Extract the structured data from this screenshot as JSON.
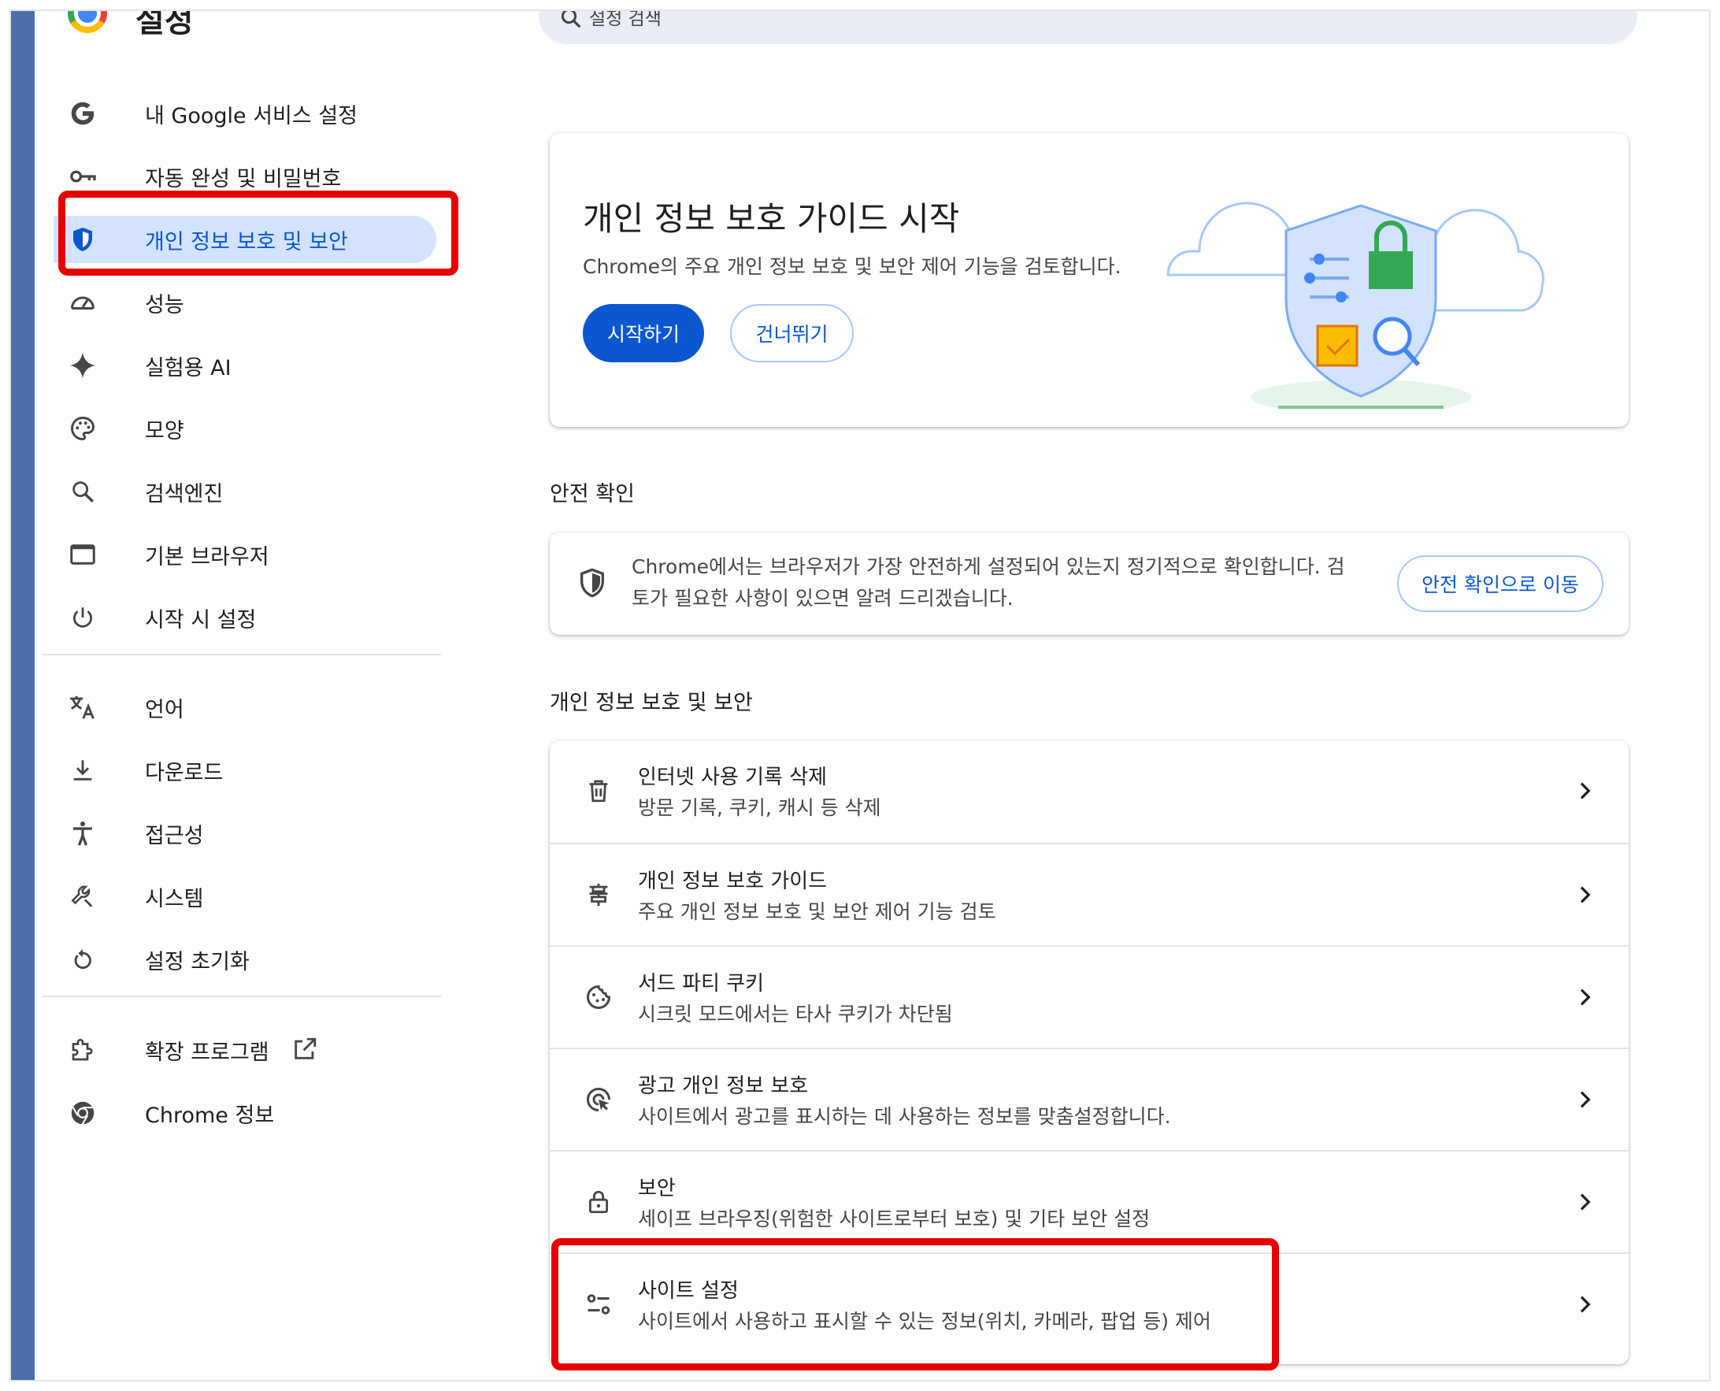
{
  "header": {
    "title": "설정",
    "search_placeholder": "설정 검색"
  },
  "sidebar": {
    "items": [
      {
        "label": "내 Google 서비스 설정",
        "icon": "google-g-icon"
      },
      {
        "label": "자동 완성 및 비밀번호",
        "icon": "key-icon"
      },
      {
        "label": "개인 정보 보호 및 보안",
        "icon": "shield-icon",
        "active": true
      },
      {
        "label": "성능",
        "icon": "speedometer-icon"
      },
      {
        "label": "실험용 AI",
        "icon": "sparkle-icon"
      },
      {
        "label": "모양",
        "icon": "palette-icon"
      },
      {
        "label": "검색엔진",
        "icon": "search-icon"
      },
      {
        "label": "기본 브라우저",
        "icon": "browser-window-icon"
      },
      {
        "label": "시작 시 설정",
        "icon": "power-icon"
      },
      {
        "label": "언어",
        "icon": "translate-icon"
      },
      {
        "label": "다운로드",
        "icon": "download-icon"
      },
      {
        "label": "접근성",
        "icon": "accessibility-icon"
      },
      {
        "label": "시스템",
        "icon": "wrench-icon"
      },
      {
        "label": "설정 초기화",
        "icon": "reset-icon"
      },
      {
        "label": "확장 프로그램",
        "icon": "puzzle-icon"
      },
      {
        "label": "Chrome 정보",
        "icon": "chrome-icon"
      }
    ]
  },
  "guide_card": {
    "title": "개인 정보 보호 가이드 시작",
    "subtitle": "Chrome의 주요 개인 정보 보호 및 보안 제어 기능을 검토합니다.",
    "start_button": "시작하기",
    "skip_button": "건너뛰기"
  },
  "safety_check": {
    "heading": "안전 확인",
    "text": "Chrome에서는 브라우저가 가장 안전하게 설정되어 있는지 정기적으로 확인합니다. 검토가 필요한 사항이 있으면 알려 드리겠습니다.",
    "button": "안전 확인으로 이동"
  },
  "privacy": {
    "heading": "개인 정보 보호 및 보안",
    "rows": [
      {
        "title": "인터넷 사용 기록 삭제",
        "subtitle": "방문 기록, 쿠키, 캐시 등 삭제",
        "icon": "trash-icon"
      },
      {
        "title": "개인 정보 보호 가이드",
        "subtitle": "주요 개인 정보 보호 및 보안 제어 기능 검토",
        "icon": "privacy-guide-icon"
      },
      {
        "title": "서드 파티 쿠키",
        "subtitle": "시크릿 모드에서는 타사 쿠키가 차단됨",
        "icon": "cookie-icon"
      },
      {
        "title": "광고 개인 정보 보호",
        "subtitle": "사이트에서 광고를 표시하는 데 사용하는 정보를 맞춤설정합니다.",
        "icon": "ad-privacy-icon"
      },
      {
        "title": "보안",
        "subtitle": "세이프 브라우징(위험한 사이트로부터 보호) 및 기타 보안 설정",
        "icon": "lock-icon"
      },
      {
        "title": "사이트 설정",
        "subtitle": "사이트에서 사용하고 표시할 수 있는 정보(위치, 카메라, 팝업 등) 제어",
        "icon": "tune-icon"
      }
    ]
  },
  "colors": {
    "accent": "#0b57d0",
    "active_bg": "#d3e3fd",
    "highlight": "#e60000",
    "left_bar": "#4a6fa8"
  }
}
